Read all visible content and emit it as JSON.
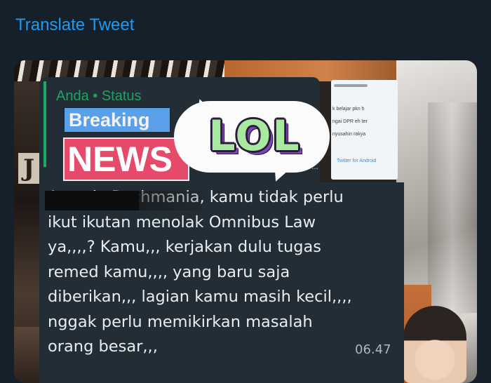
{
  "tweet": {
    "translate_label": "Translate Tweet"
  },
  "media": {
    "background_letter": "J",
    "status_reply": {
      "title": "Anda • Status",
      "breaking_label": "Breaking",
      "news_label": "NEWS",
      "sticker_label": "LOL",
      "ellipsis": "...",
      "thumbnail_lines": [
        "k belajar pkn h",
        "ngai DPR eh ter",
        "nyusahin rakya",
        "Twitter for Android"
      ]
    },
    "message": {
      "text": "Ayunda Rachmania, kamu tidak perlu\nikut ikutan menolak Omnibus Law\nya,,,,? Kamu,,, kerjakan dulu tugas\nremed kamu,,,, yang baru saja\ndiberikan,,, lagian kamu masih kecil,,,,\nnggak perlu memikirkan masalah\norang besar,,,",
      "time": "06.47"
    }
  },
  "colors": {
    "background": "#15202b",
    "link": "#1d9bf0",
    "bubble": "#222d35",
    "status_green": "#1ea361",
    "breaking_blue": "#5aa0e8",
    "news_pink": "#e64a6a",
    "lol_green": "#a8e9a0",
    "lol_purple": "#7c46b8"
  }
}
